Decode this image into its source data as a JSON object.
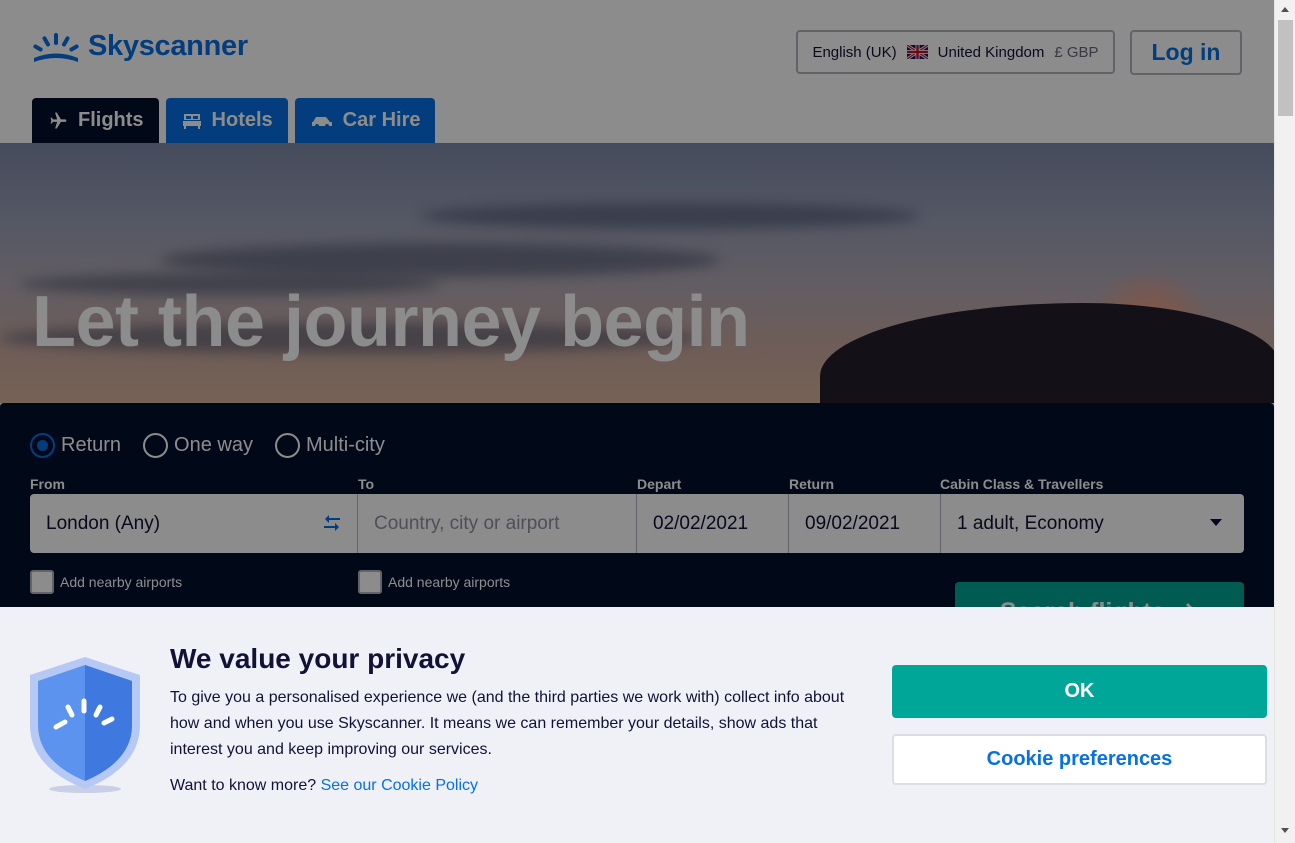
{
  "header": {
    "logo_text": "Skyscanner",
    "locale": {
      "language": "English (UK)",
      "country": "United Kingdom",
      "currency": "£ GBP"
    },
    "login_label": "Log in"
  },
  "tabs": [
    {
      "label": "Flights",
      "icon": "plane-icon",
      "active": true
    },
    {
      "label": "Hotels",
      "icon": "bed-icon",
      "active": false
    },
    {
      "label": "Car Hire",
      "icon": "car-icon",
      "active": false
    }
  ],
  "hero": {
    "title": "Let the journey begin"
  },
  "search": {
    "trip_types": [
      {
        "label": "Return",
        "selected": true
      },
      {
        "label": "One way",
        "selected": false
      },
      {
        "label": "Multi-city",
        "selected": false
      }
    ],
    "from": {
      "label": "From",
      "value": "London (Any)"
    },
    "to": {
      "label": "To",
      "placeholder": "Country, city or airport"
    },
    "depart": {
      "label": "Depart",
      "value": "02/02/2021"
    },
    "return": {
      "label": "Return",
      "value": "09/02/2021"
    },
    "cabin": {
      "label": "Cabin Class & Travellers",
      "value": "1 adult, Economy"
    },
    "nearby_label": "Add nearby airports",
    "submit_label": "Search flights"
  },
  "cookie_banner": {
    "title": "We value your privacy",
    "body": "To give you a personalised experience we (and the third parties we work with) collect info about how and when you use Skyscanner. It means we can remember your details, show ads that interest you and keep improving our services.",
    "more_text": "Want to know more?",
    "policy_link": "See our Cookie Policy",
    "ok_label": "OK",
    "preferences_label": "Cookie preferences"
  },
  "colors": {
    "brand_blue": "#0770e3",
    "navy": "#02122c",
    "teal": "#00a698",
    "banner_bg": "#eff1f7"
  }
}
